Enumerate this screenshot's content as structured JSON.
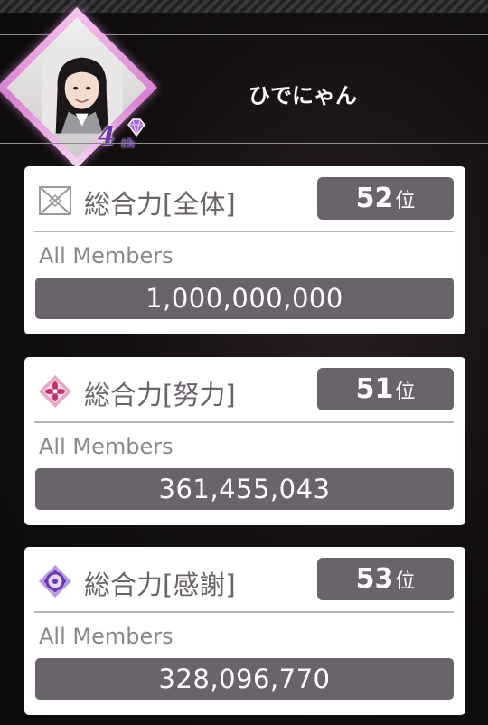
{
  "profile": {
    "username": "ひでにゃん",
    "anniversary_badge": {
      "number": "4",
      "suffix": "th"
    }
  },
  "rankings": [
    {
      "icon": "crossed-outline-icon",
      "category": "総合力[全体]",
      "rank_number": "52",
      "rank_unit": "位",
      "scope": "All Members",
      "score": "1,000,000,000"
    },
    {
      "icon": "pink-flower-diamond-icon",
      "category": "総合力[努力]",
      "rank_number": "51",
      "rank_unit": "位",
      "scope": "All Members",
      "score": "361,455,043"
    },
    {
      "icon": "purple-ring-diamond-icon",
      "category": "総合力[感謝]",
      "rank_number": "53",
      "rank_unit": "位",
      "scope": "All Members",
      "score": "328,096,770"
    }
  ],
  "colors": {
    "badge_bg": "#6b636b",
    "card_bg": "#ffffff",
    "frame_pink": "#d77ed0",
    "fourth_purple": "#6c35a8"
  }
}
